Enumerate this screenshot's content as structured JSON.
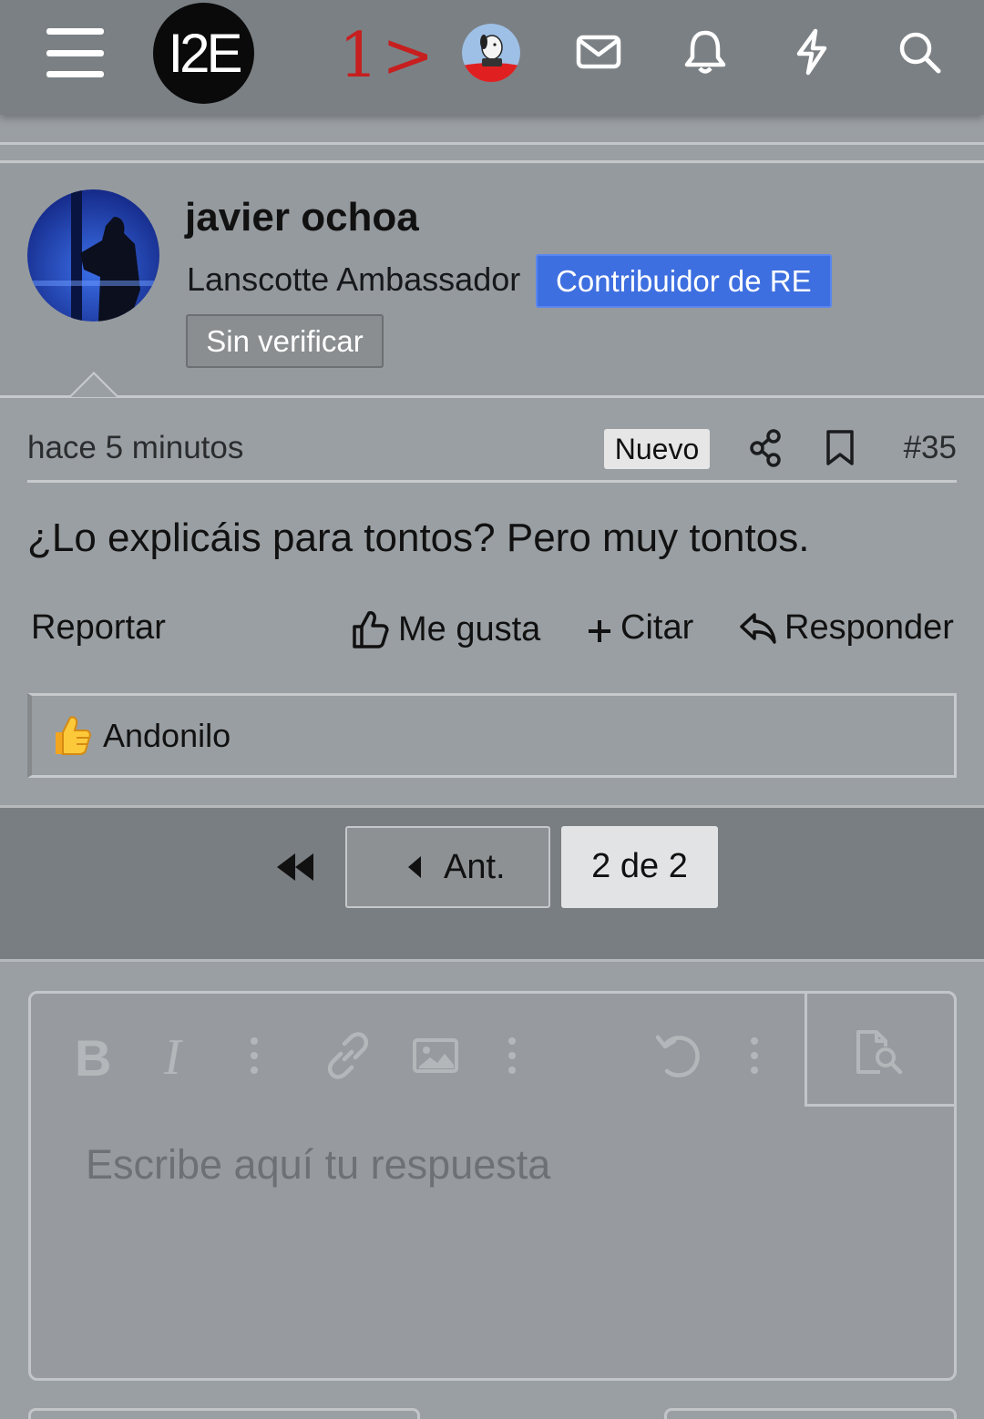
{
  "nav": {
    "logo_text": "I2E",
    "annotation_text": "1>",
    "icons": [
      "menu-icon",
      "user-avatar",
      "mail-icon",
      "bell-icon",
      "bolt-icon",
      "search-icon"
    ]
  },
  "post": {
    "author": "javier ochoa",
    "user_title": "Lanscotte Ambassador",
    "role_badge": "Contribuidor de RE",
    "verify_badge": "Sin verificar",
    "time": "hace 5 minutos",
    "new_badge": "Nuevo",
    "number": "#35",
    "text": "¿Lo explicáis para tontos? Pero muy tontos.",
    "actions": {
      "report": "Reportar",
      "like": "Me gusta",
      "quote": "Citar",
      "reply": "Responder"
    },
    "reactions": {
      "emoji": "👍",
      "users": "Andonilo"
    }
  },
  "pagination": {
    "prev_label": "Ant.",
    "current": "2 de 2"
  },
  "editor": {
    "placeholder": "Escribe aquí tu respuesta",
    "toolbar": [
      "bold-icon",
      "italic-icon",
      "more-vertical-icon",
      "link-icon",
      "image-icon",
      "more-vertical-icon",
      "undo-icon",
      "more-vertical-icon",
      "preview-icon"
    ],
    "bold_glyph": "B",
    "italic_glyph": "I"
  },
  "colors": {
    "role_badge": "#3e6fe0",
    "annotation": "#c71f1f",
    "topbar": "#7b8084"
  }
}
